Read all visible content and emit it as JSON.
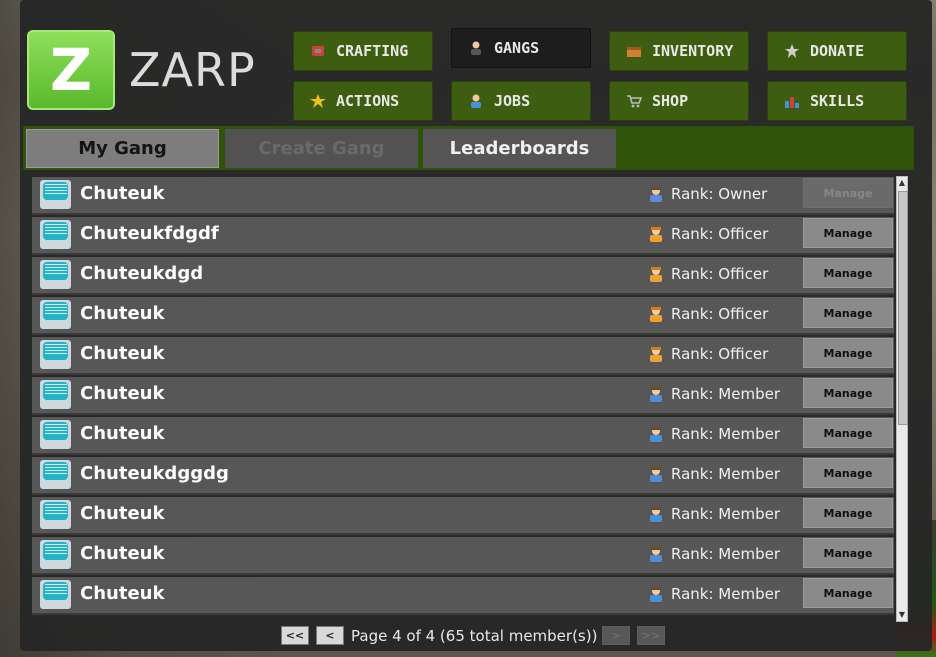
{
  "brand": {
    "letter": "Z",
    "name": "ZARP",
    "logo_green": "#6fce3e"
  },
  "nav": [
    {
      "label": "CRAFTING",
      "icon": "crafting-icon",
      "active": false
    },
    {
      "label": "GANGS",
      "icon": "gangs-icon",
      "active": true
    },
    {
      "label": "INVENTORY",
      "icon": "inventory-icon",
      "active": false
    },
    {
      "label": "DONATE",
      "icon": "donate-icon",
      "active": false
    },
    {
      "label": "ACTIONS",
      "icon": "star-icon",
      "active": false
    },
    {
      "label": "JOBS",
      "icon": "jobs-icon",
      "active": false
    },
    {
      "label": "SHOP",
      "icon": "cart-icon",
      "active": false
    },
    {
      "label": "SKILLS",
      "icon": "chart-icon",
      "active": false
    }
  ],
  "tabs": [
    {
      "label": "My Gang",
      "state": "selected"
    },
    {
      "label": "Create Gang",
      "state": "disabled"
    },
    {
      "label": "Leaderboards",
      "state": "normal"
    }
  ],
  "members": [
    {
      "name": "Chuteuk",
      "rank": "Rank: Owner",
      "role": "owner",
      "manage": "Manage",
      "manage_enabled": false
    },
    {
      "name": "Chuteukfdgdf",
      "rank": "Rank: Officer",
      "role": "officer",
      "manage": "Manage",
      "manage_enabled": true
    },
    {
      "name": "Chuteukdgd",
      "rank": "Rank: Officer",
      "role": "officer",
      "manage": "Manage",
      "manage_enabled": true
    },
    {
      "name": "Chuteuk",
      "rank": "Rank: Officer",
      "role": "officer",
      "manage": "Manage",
      "manage_enabled": true
    },
    {
      "name": "Chuteuk",
      "rank": "Rank: Officer",
      "role": "officer",
      "manage": "Manage",
      "manage_enabled": true
    },
    {
      "name": "Chuteuk",
      "rank": "Rank: Member",
      "role": "member",
      "manage": "Manage",
      "manage_enabled": true
    },
    {
      "name": "Chuteuk",
      "rank": "Rank: Member",
      "role": "member",
      "manage": "Manage",
      "manage_enabled": true
    },
    {
      "name": "Chuteukdggdg",
      "rank": "Rank: Member",
      "role": "member",
      "manage": "Manage",
      "manage_enabled": true
    },
    {
      "name": "Chuteuk",
      "rank": "Rank: Member",
      "role": "member",
      "manage": "Manage",
      "manage_enabled": true
    },
    {
      "name": "Chuteuk",
      "rank": "Rank: Member",
      "role": "member",
      "manage": "Manage",
      "manage_enabled": true
    },
    {
      "name": "Chuteuk",
      "rank": "Rank: Member",
      "role": "member",
      "manage": "Manage",
      "manage_enabled": true
    }
  ],
  "pager": {
    "first": "<<",
    "prev": "<",
    "next": ">",
    "last": ">>",
    "text": "Page 4 of 4 (65 total member(s))",
    "first_enabled": true,
    "prev_enabled": true,
    "next_enabled": false,
    "last_enabled": false
  },
  "colors": {
    "nav_green": "#3d5e10",
    "tabbar_green": "#2f5409",
    "owner_icon": "#5b8ed6",
    "officer_icon": "#f0a030",
    "member_icon": "#4a90d9"
  }
}
